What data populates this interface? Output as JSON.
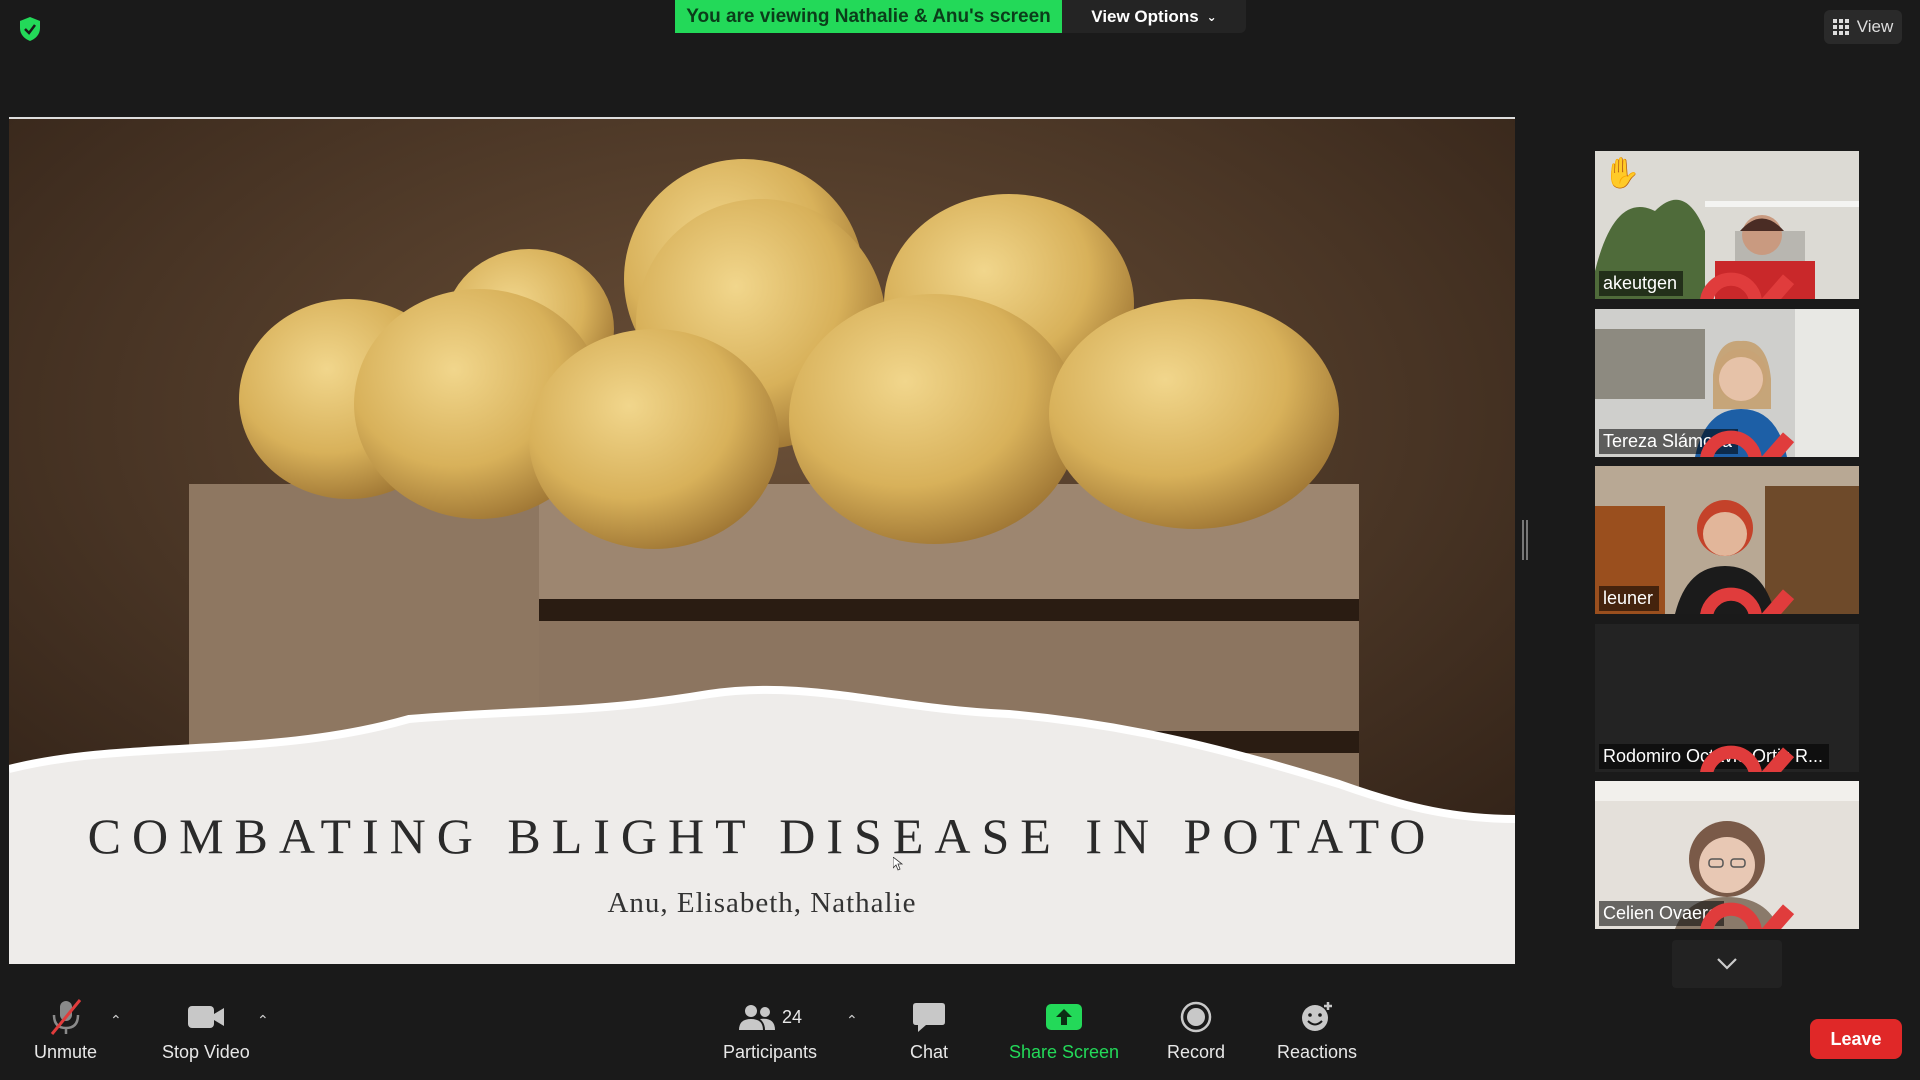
{
  "banner": {
    "text": "You are viewing Nathalie & Anu's screen",
    "view_options": "View Options"
  },
  "topright": {
    "view_label": "View"
  },
  "slide": {
    "title": "COMBATING BLIGHT DISEASE IN POTATO",
    "subtitle": "Anu, Elisabeth, Nathalie"
  },
  "participants": [
    {
      "name": "akeutgen",
      "muted": true,
      "hand_raised": true
    },
    {
      "name": "Tereza Slámová",
      "muted": true,
      "hand_raised": false
    },
    {
      "name": "leuner",
      "muted": true,
      "hand_raised": false
    },
    {
      "name": "Rodomiro Octavio Ortiz R...",
      "muted": true,
      "hand_raised": false
    },
    {
      "name": "Celien Ovaere",
      "muted": true,
      "hand_raised": false
    }
  ],
  "toolbar": {
    "unmute": "Unmute",
    "stop_video": "Stop Video",
    "participants": "Participants",
    "participant_count": "24",
    "chat": "Chat",
    "share_screen": "Share Screen",
    "record": "Record",
    "reactions": "Reactions",
    "leave": "Leave"
  },
  "colors": {
    "share_green": "#23d959",
    "leave_red": "#e02828",
    "background": "#1a1a1a"
  }
}
